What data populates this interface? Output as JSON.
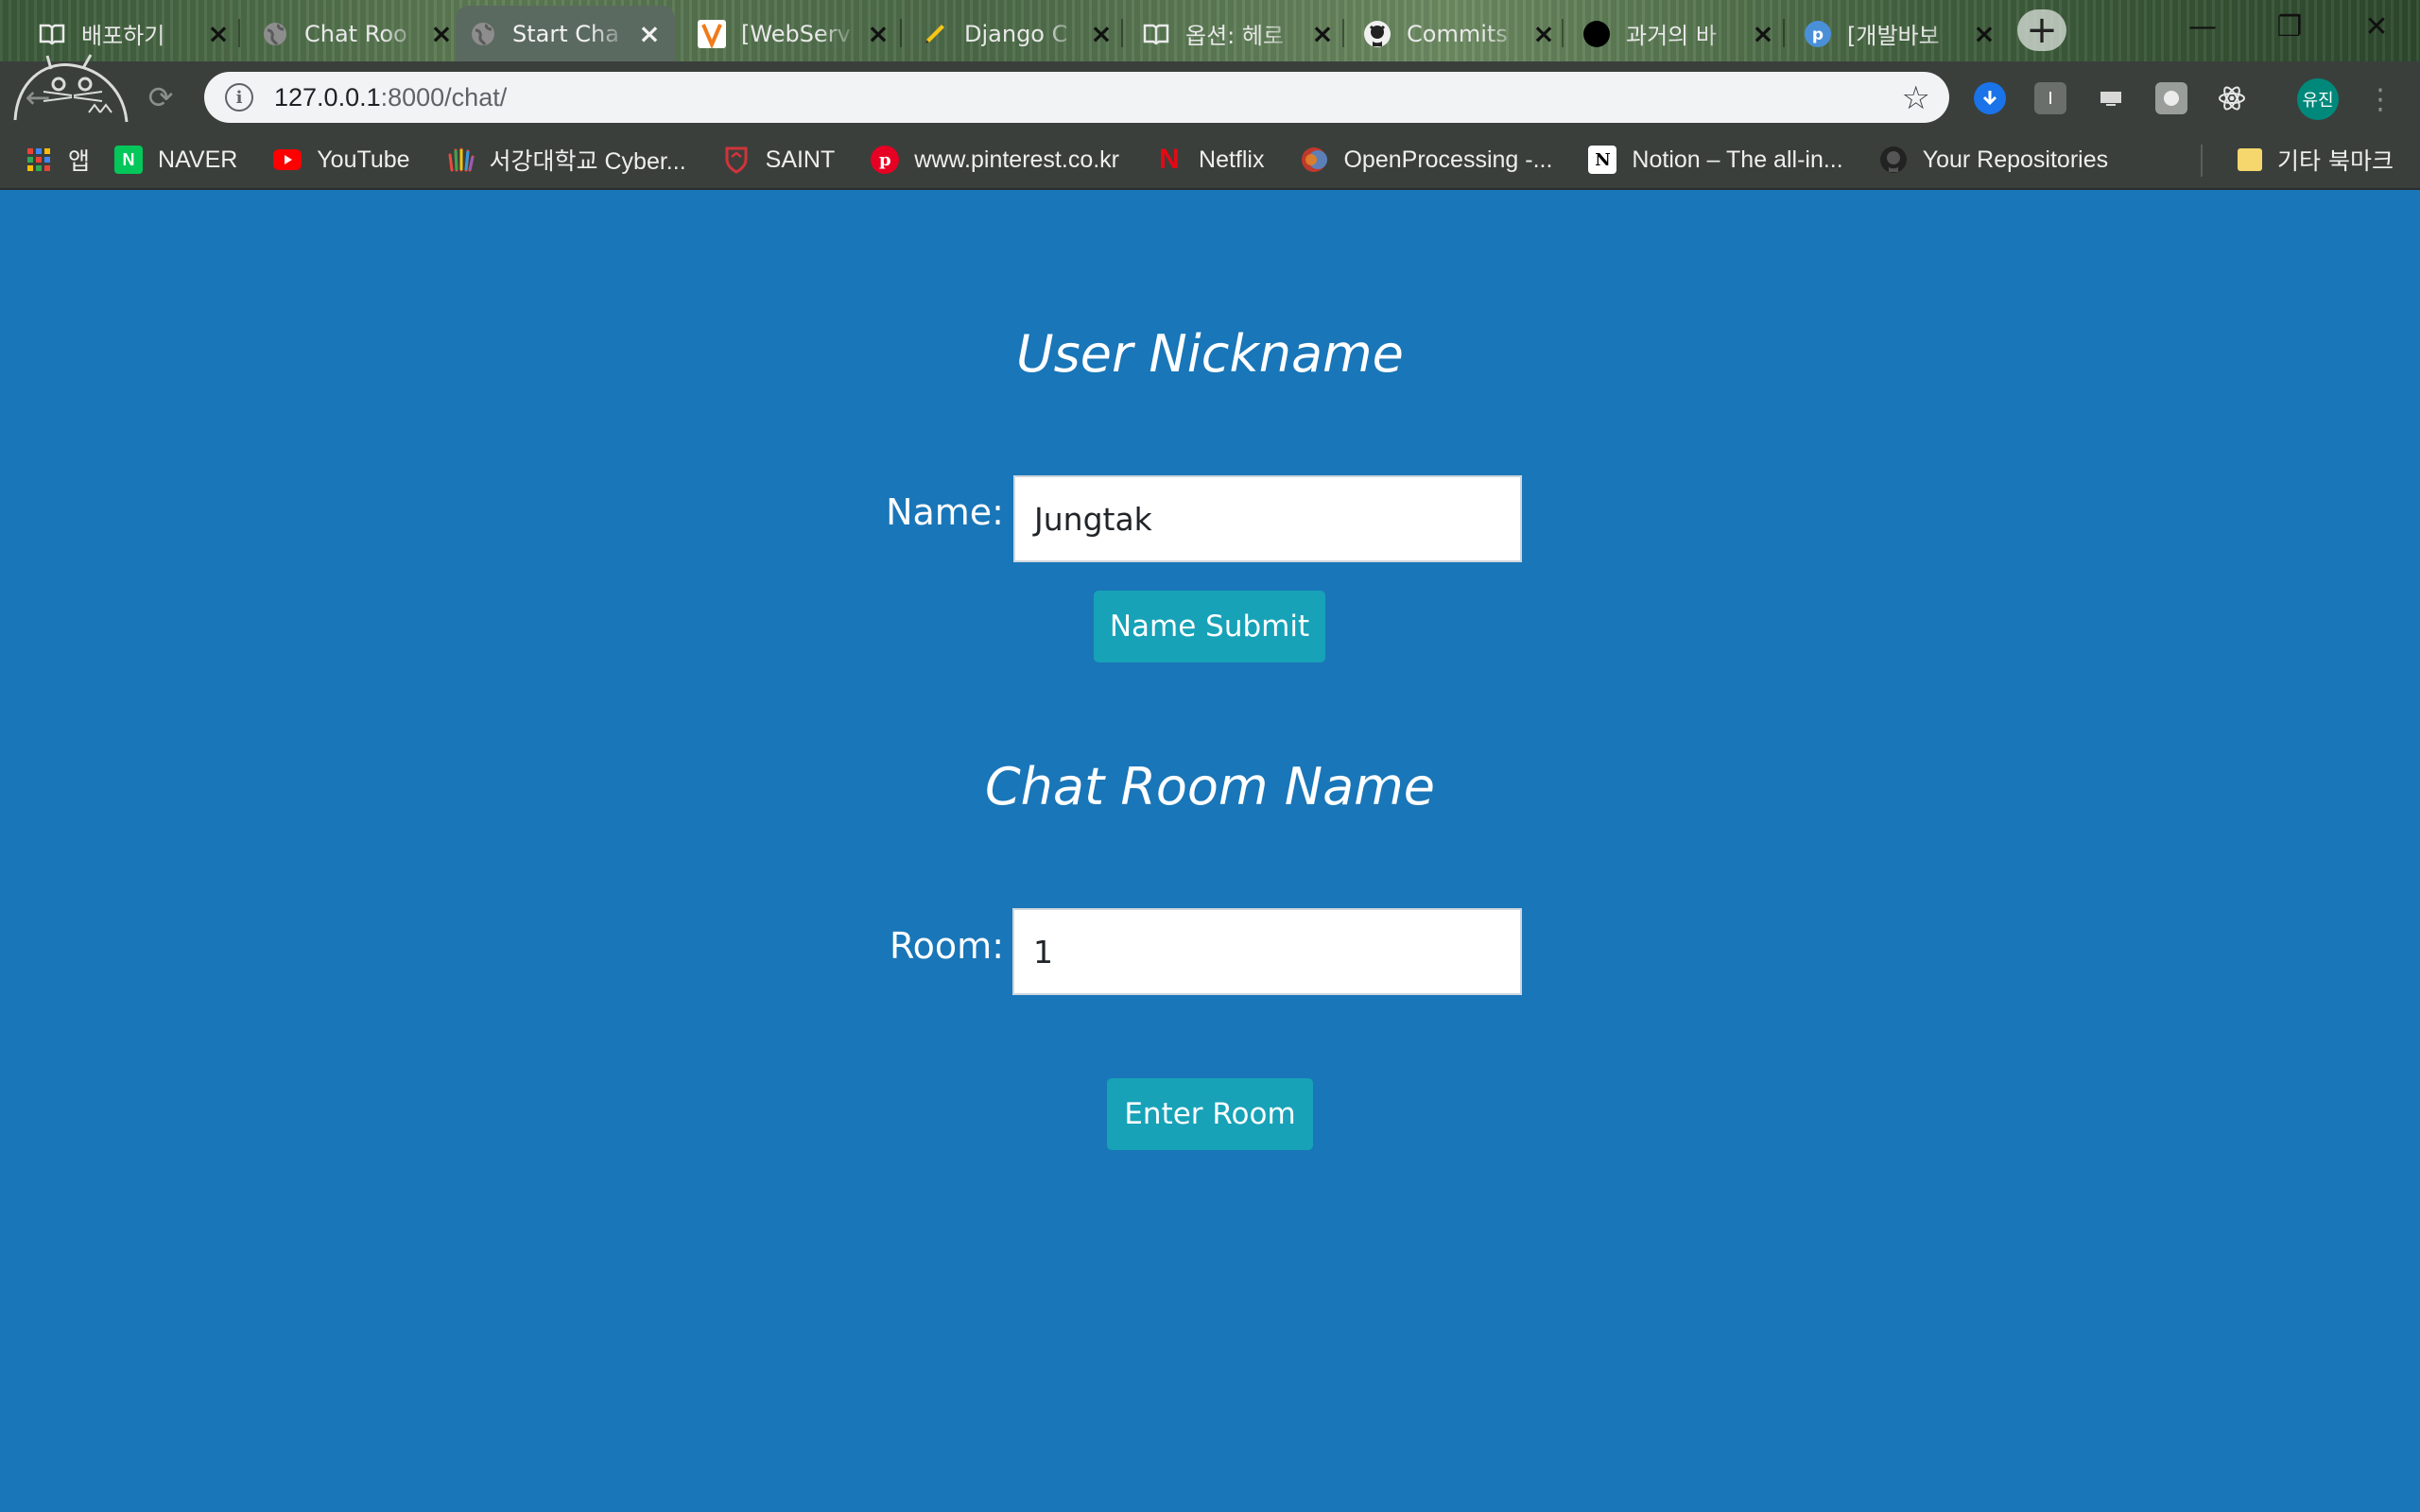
{
  "browser": {
    "tabs": [
      {
        "title": "배포하기",
        "favicon": "book-icon"
      },
      {
        "title": "Chat Roo",
        "favicon": "globe-icon"
      },
      {
        "title": "Start Cha",
        "favicon": "globe-icon",
        "active": true
      },
      {
        "title": "[WebServ",
        "favicon": "v-logo-icon"
      },
      {
        "title": "Django C",
        "favicon": "pencil-icon"
      },
      {
        "title": "옵션: 헤로",
        "favicon": "book-icon"
      },
      {
        "title": "Commits",
        "favicon": "github-icon"
      },
      {
        "title": "과거의 바",
        "favicon": "black-circle-icon"
      },
      {
        "title": "[개발바보",
        "favicon": "p-logo-icon"
      }
    ],
    "new_tab_glyph": "+",
    "window_controls": {
      "minimize": "—",
      "restore": "❐",
      "close": "✕"
    },
    "address_bar": {
      "host": "127.0.0.1",
      "rest": ":8000/chat/"
    },
    "profile_label": "유진",
    "bookmarks": [
      {
        "label": "앱",
        "icon": "apps-grid-icon"
      },
      {
        "label": "NAVER",
        "icon": "naver-icon"
      },
      {
        "label": "YouTube",
        "icon": "youtube-icon"
      },
      {
        "label": "서강대학교 Cyber...",
        "icon": "hand-logo-icon"
      },
      {
        "label": "SAINT",
        "icon": "shield-logo-icon"
      },
      {
        "label": "www.pinterest.co.kr",
        "icon": "pinterest-icon"
      },
      {
        "label": "Netflix",
        "icon": "netflix-icon"
      },
      {
        "label": "OpenProcessing -...",
        "icon": "openprocessing-icon"
      },
      {
        "label": "Notion – The all-in...",
        "icon": "notion-icon"
      },
      {
        "label": "Your Repositories",
        "icon": "github-icon"
      }
    ],
    "other_bookmarks": "기타 북마크"
  },
  "page": {
    "nickname_heading": "User Nickname",
    "name_label": "Name:",
    "name_value": "Jungtak",
    "name_submit": "Name Submit",
    "room_heading": "Chat Room Name",
    "room_label": "Room:",
    "room_value": "1",
    "enter_room": "Enter Room"
  },
  "colors": {
    "page_background": "#1976b8",
    "button": "#17a2b8",
    "active_tab": "#5b6a60",
    "toolbar": "#3a3f3c"
  }
}
